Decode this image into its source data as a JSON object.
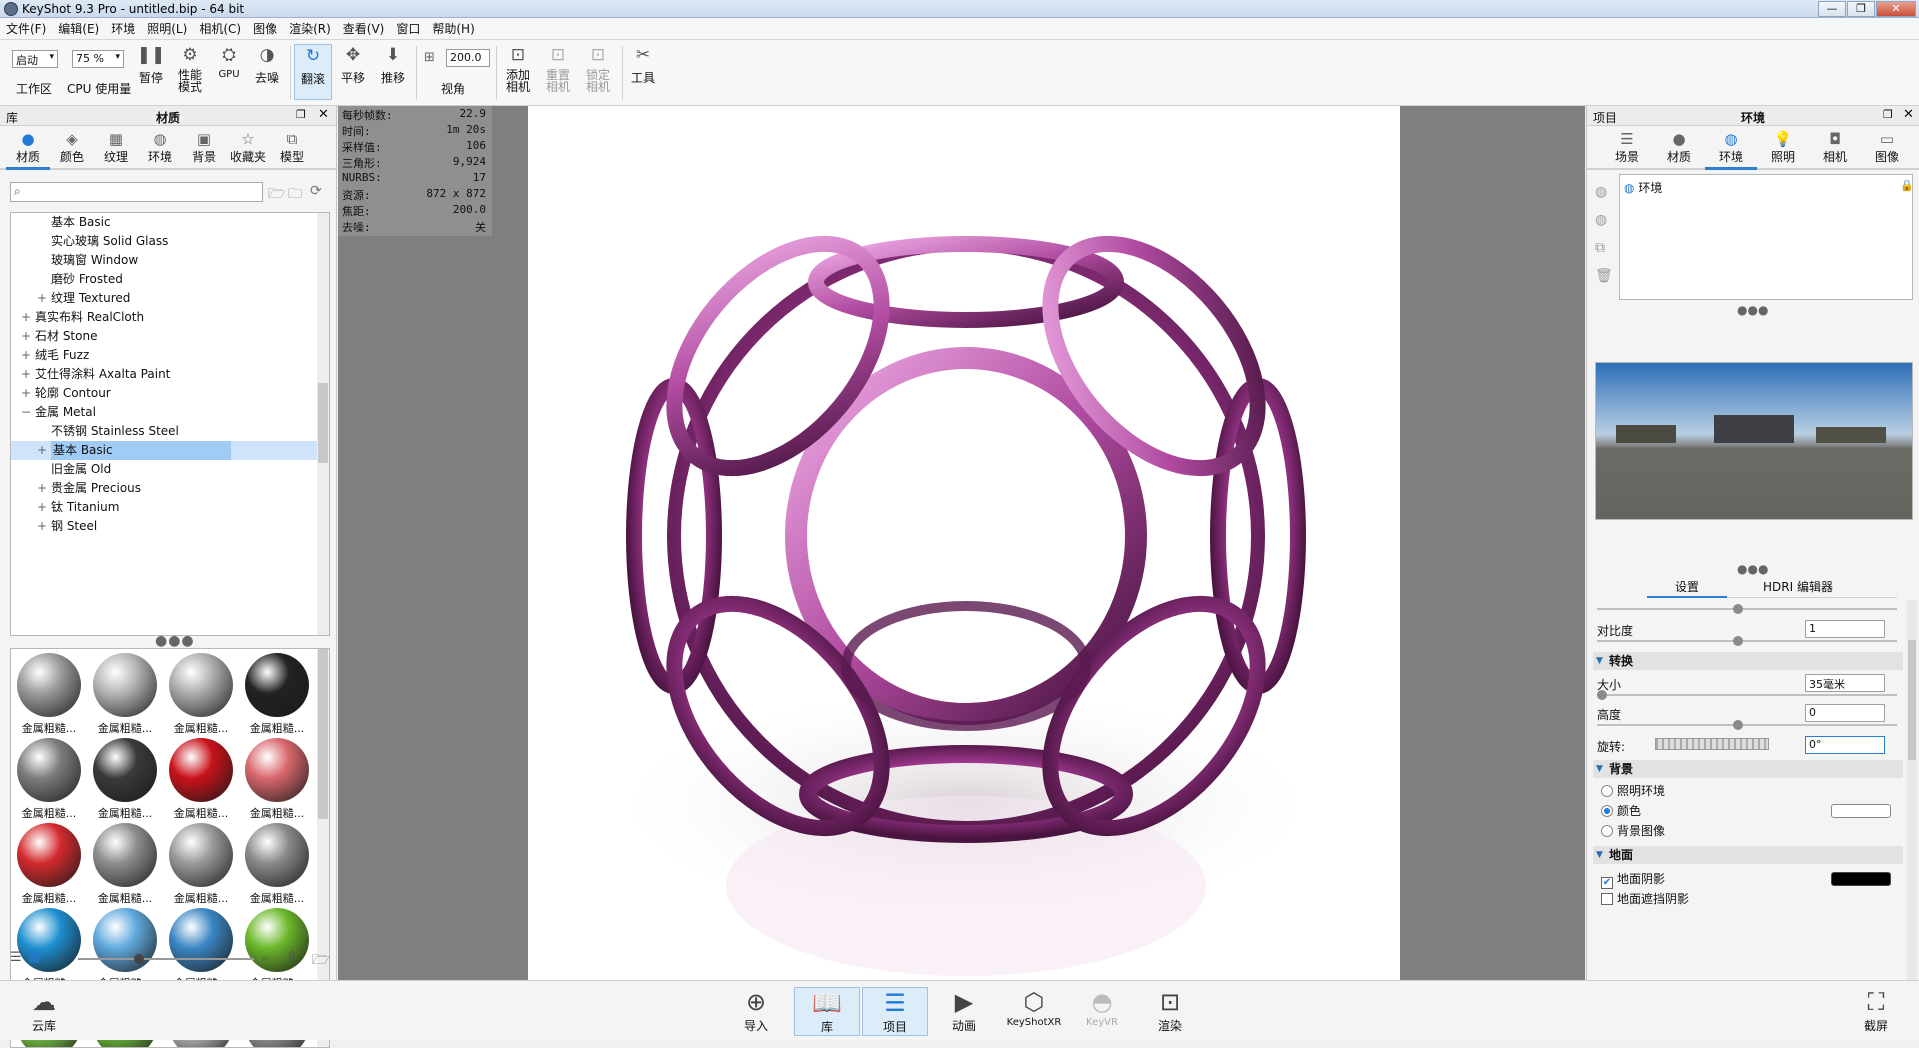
{
  "window": {
    "title": "KeyShot 9.3 Pro  - untitled.bip  - 64 bit"
  },
  "menu": [
    "文件(F)",
    "编辑(E)",
    "环境",
    "照明(L)",
    "相机(C)",
    "图像",
    "渲染(R)",
    "查看(V)",
    "窗口",
    "帮助(H)"
  ],
  "toolbar": {
    "workspace_value": "启动",
    "workspace_label": "工作区",
    "cpu_value": "75 %",
    "cpu_label": "CPU 使用量",
    "pause": "暂停",
    "perf_mode": "性能\n模式",
    "gpu": "GPU",
    "denoise": "去噪",
    "tumble": "翻滚",
    "pan": "平移",
    "dolly": "推移",
    "fov_value": "200.0",
    "fov_label": "视角",
    "add_camera": "添加\n相机",
    "reset_camera": "重置\n相机",
    "lock_camera": "锁定\n相机",
    "tools": "工具"
  },
  "left": {
    "header_left": "库",
    "header_title": "材质",
    "tabs": [
      "材质",
      "颜色",
      "纹理",
      "环境",
      "背景",
      "收藏夹",
      "模型"
    ],
    "tree": [
      {
        "label": "基本 Basic",
        "indent": 2,
        "pm": ""
      },
      {
        "label": "实心玻璃 Solid Glass",
        "indent": 2,
        "pm": ""
      },
      {
        "label": "玻璃窗 Window",
        "indent": 2,
        "pm": ""
      },
      {
        "label": "磨砂 Frosted",
        "indent": 2,
        "pm": ""
      },
      {
        "label": "纹理 Textured",
        "indent": 2,
        "pm": "+"
      },
      {
        "label": "真实布料 RealCloth",
        "indent": 1,
        "pm": "+"
      },
      {
        "label": "石材 Stone",
        "indent": 1,
        "pm": "+"
      },
      {
        "label": "绒毛 Fuzz",
        "indent": 1,
        "pm": "+"
      },
      {
        "label": "艾仕得涂料 Axalta Paint",
        "indent": 1,
        "pm": "+"
      },
      {
        "label": "轮廓 Contour",
        "indent": 1,
        "pm": "+"
      },
      {
        "label": "金属 Metal",
        "indent": 1,
        "pm": "−"
      },
      {
        "label": "不锈钢 Stainless Steel",
        "indent": 2,
        "pm": ""
      },
      {
        "label": "基本 Basic",
        "indent": 2,
        "pm": "+",
        "sel": true
      },
      {
        "label": "旧金属 Old",
        "indent": 2,
        "pm": ""
      },
      {
        "label": "贵金属 Precious",
        "indent": 2,
        "pm": "+"
      },
      {
        "label": "钛 Titanium",
        "indent": 2,
        "pm": "+"
      },
      {
        "label": "钢 Steel",
        "indent": 2,
        "pm": "+"
      }
    ],
    "thumb_label": "金属粗糙...",
    "thumb_colors": [
      "#9c9c9c",
      "#b5b5b5",
      "#adadad",
      "#222222",
      "#7d7d7d",
      "#3a3a3a",
      "#c8121a",
      "#d8676c",
      "#d32a2e",
      "#8e8e8e",
      "#9a9a9a",
      "#8a8a8a",
      "#1e8fd0",
      "#5fa9dd",
      "#3b86c4",
      "#6bb82a",
      "#7ac746",
      "#6dbd3a",
      "#bcbcbc",
      "#9a9a9a"
    ]
  },
  "stats": [
    [
      "每秒帧数:",
      "22.9"
    ],
    [
      "时间:",
      "1m 20s"
    ],
    [
      "采样值:",
      "106"
    ],
    [
      "三角形:",
      "9,924"
    ],
    [
      "NURBS:",
      "17"
    ],
    [
      "资源:",
      "872 x 872"
    ],
    [
      "焦距:",
      "200.0"
    ],
    [
      "去噪:",
      "关"
    ]
  ],
  "right": {
    "header_left": "项目",
    "header_title": "环境",
    "tabs": [
      "场景",
      "材质",
      "环境",
      "照明",
      "相机",
      "图像"
    ],
    "env_item": "环境",
    "subtabs": [
      "设置",
      "HDRI 编辑器"
    ],
    "contrast_label": "对比度",
    "contrast_value": "1",
    "section_transform": "转换",
    "size_label": "大小",
    "size_value": "35毫米",
    "height_label": "高度",
    "height_value": "0",
    "rotation_label": "旋转:",
    "rotation_value": "0°",
    "section_background": "背景",
    "bg_options": [
      "照明环境",
      "颜色",
      "背景图像"
    ],
    "section_ground": "地面",
    "ground_shadow": "地面阴影",
    "ground_occlusion": "地面遮挡阴影"
  },
  "bottom": {
    "cloud": "云库",
    "import": "导入",
    "library": "库",
    "project": "项目",
    "animation": "动画",
    "keyshotxr": "KeyShotXR",
    "keyvr": "KeyVR",
    "render": "渲染",
    "screenshot": "截屏"
  }
}
